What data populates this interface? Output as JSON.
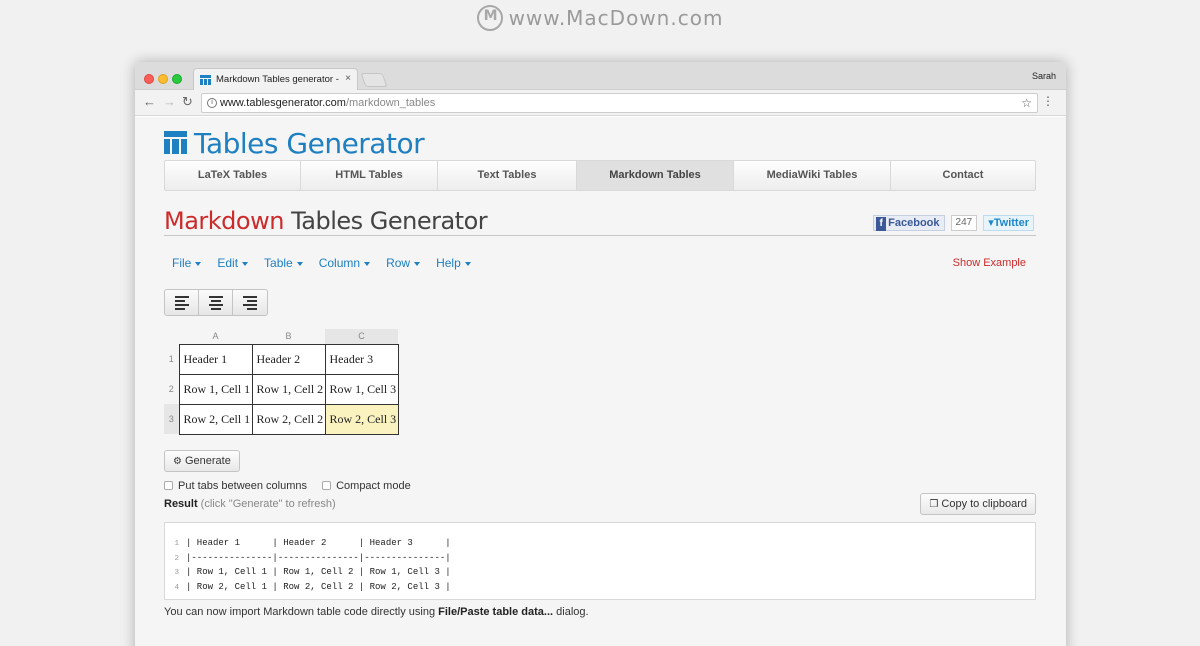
{
  "watermark": "www.MacDown.com",
  "browser": {
    "tab_title": "Markdown Tables generator -",
    "tab_close": "×",
    "profile": "Sarah",
    "url_host": "www.tablesgenerator.com",
    "url_path": "/markdown_tables"
  },
  "site": {
    "logo_text": "Tables Generator",
    "brand_color": "#1e7fc1",
    "nav": [
      "LaTeX Tables",
      "HTML Tables",
      "Text Tables",
      "Markdown Tables",
      "MediaWiki Tables",
      "Contact"
    ],
    "active_nav": "Markdown Tables"
  },
  "page": {
    "title_highlight": "Markdown",
    "title_rest": " Tables Generator",
    "highlight_color": "#cc2b2b",
    "share": {
      "facebook": "Facebook",
      "count": "247",
      "twitter": "Twitter"
    }
  },
  "menu": {
    "items": [
      "File",
      "Edit",
      "Table",
      "Column",
      "Row",
      "Help"
    ],
    "show_example": "Show Example"
  },
  "align_buttons": [
    "align-left-icon",
    "align-center-icon",
    "align-right-icon"
  ],
  "grid": {
    "columns": [
      "A",
      "B",
      "C"
    ],
    "rows": [
      {
        "num": "1",
        "cells": [
          "Header 1",
          "Header 2",
          "Header 3"
        ]
      },
      {
        "num": "2",
        "cells": [
          "Row 1, Cell 1",
          "Row 1, Cell 2",
          "Row 1, Cell 3"
        ]
      },
      {
        "num": "3",
        "cells": [
          "Row 2, Cell 1",
          "Row 2, Cell 2",
          "Row 2, Cell 3"
        ]
      }
    ],
    "selected_cell": "C3"
  },
  "actions": {
    "generate": "Generate",
    "copy": "Copy to clipboard",
    "opt_tabs": "Put tabs between columns",
    "opt_compact": "Compact mode",
    "result_label": "Result",
    "result_hint": " (click \"Generate\" to refresh)"
  },
  "code": [
    {
      "ln": "1",
      "text": "| Header 1      | Header 2      | Header 3      |"
    },
    {
      "ln": "2",
      "text": "|---------------|---------------|---------------|"
    },
    {
      "ln": "3",
      "text": "| Row 1, Cell 1 | Row 1, Cell 2 | Row 1, Cell 3 |"
    },
    {
      "ln": "4",
      "text": "| Row 2, Cell 1 | Row 2, Cell 2 | Row 2, Cell 3 |"
    }
  ],
  "footer": {
    "before": "You can now import Markdown table code directly using ",
    "bold": "File/Paste table data...",
    "after": " dialog."
  }
}
